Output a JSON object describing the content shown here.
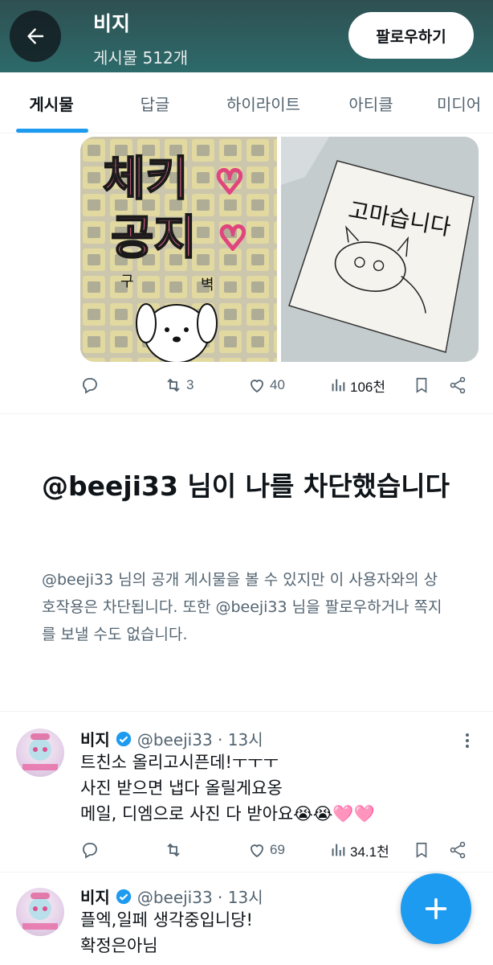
{
  "header": {
    "title": "비지",
    "post_count": "게시물 512개",
    "follow_label": "팔로우하기",
    "back_icon": "arrow-left-icon"
  },
  "tabs": [
    {
      "label": "게시물",
      "active": true
    },
    {
      "label": "답글",
      "active": false
    },
    {
      "label": "하이라이트",
      "active": false
    },
    {
      "label": "아티클",
      "active": false
    },
    {
      "label": "미디어",
      "active": false
    }
  ],
  "media_post": {
    "left_image_text": [
      "체키",
      "공지"
    ],
    "left_image_small": [
      "구",
      "벽"
    ],
    "right_image_text": "고마습니다",
    "actions": {
      "reply": "",
      "retweet": "3",
      "like": "40",
      "views": "106천"
    }
  },
  "block_notice": {
    "title": "@beeji33 님이 나를 차단했습니다",
    "description": "@beeji33 님의 공개 게시물을 볼 수 있지만 이 사용자와의 상호작용은 차단됩니다. 또한 @beeji33 님을 팔로우하거나 쪽지를 보낼 수도 없습니다."
  },
  "tweets": [
    {
      "name": "비지",
      "handle": "@beeji33 · 13시",
      "text": "트친소 올리고시픈데!ㅜㅜㅜ\n사진 받으면 냅다 올릴게요옹\n메일, 디엠으로 사진 다 받아요😭😭🩷🩷",
      "actions": {
        "reply": "",
        "retweet": "",
        "like": "69",
        "views": "34.1천"
      }
    },
    {
      "name": "비지",
      "handle": "@beeji33 · 13시",
      "text": "플엑,일페 생각중입니당!\n확정은아님"
    }
  ],
  "colors": {
    "accent": "#1d9bf0",
    "header_bg": "#2d6a6a",
    "muted_text": "#536471"
  },
  "fab_icon": "plus-icon"
}
